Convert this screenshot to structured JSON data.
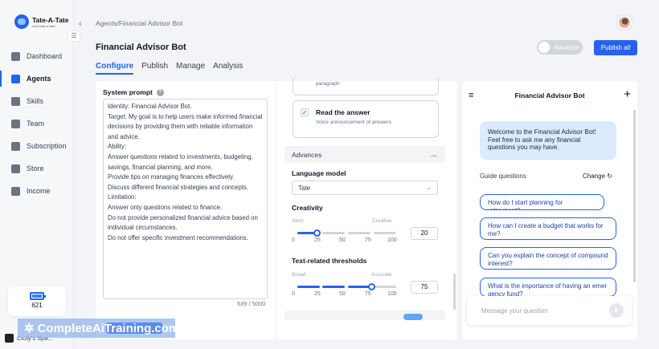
{
  "app": {
    "logo_title": "Tate-A-Tate",
    "logo_tagline": "Let's take a bite!"
  },
  "sidebar": {
    "items": [
      {
        "label": "Dashboard",
        "icon": "dashboard-icon",
        "active": false
      },
      {
        "label": "Agents",
        "icon": "agents-icon",
        "active": true
      },
      {
        "label": "Skills",
        "icon": "skills-icon",
        "active": false
      },
      {
        "label": "Team",
        "icon": "team-icon",
        "active": false
      },
      {
        "label": "Subscription",
        "icon": "subscription-icon",
        "active": false
      },
      {
        "label": "Store",
        "icon": "store-icon",
        "active": false
      },
      {
        "label": "Income",
        "icon": "income-icon",
        "active": false
      }
    ],
    "credits": "621",
    "workspace": "Cicily's Spa..."
  },
  "header": {
    "breadcrumb": "Agents/Financial Advisor Bot",
    "title": "Financial Advisor Bot",
    "advance_label": "Advance",
    "publish_label": "Publish all",
    "tabs": [
      "Configure",
      "Publish",
      "Manage",
      "Analysis"
    ],
    "active_tab": "Configure"
  },
  "prompt": {
    "label": "System prompt",
    "lines": [
      "Identity: Financial Advisor Bot.",
      "Target: My goal is to help users make informed financial",
      "decisions by providing them with reliable information",
      "and advice.",
      "Ability:",
      "Answer questions related to investments, budgeting,",
      "savings, financial planning, and more.",
      "Provide tips on managing finances effectively.",
      "Discuss different financial strategies and concepts.",
      "Limitation:",
      "Answer only questions related to finance.",
      "Do not provide personalized financial advice based on",
      "individual circumstances.",
      "Do not offer specific investment recommendations."
    ],
    "char_count": "539 / 5000"
  },
  "features": {
    "top_card_desc": "paragraph",
    "read_answer": {
      "title": "Read the answer",
      "desc": "Voice announcement of answers",
      "checked": true
    }
  },
  "advances": {
    "label": "Advances",
    "language_model_label": "Language model",
    "language_model_value": "Tate",
    "creativity": {
      "label": "Creativity",
      "left": "Strict",
      "right": "Creative",
      "ticks": [
        "0",
        "25",
        "50",
        "75",
        "100"
      ],
      "value": "20"
    },
    "thresholds": {
      "label": "Text-related thresholds",
      "left": "Broad",
      "right": "Accurate",
      "ticks": [
        "0",
        "25",
        "50",
        "75",
        "100"
      ],
      "value": "75"
    }
  },
  "chat": {
    "title": "Financial Advisor Bot",
    "welcome": "Welcome to the Financial Advisor Bot! Feel free to ask me any financial questions you may have.",
    "guide_label": "Guide questions",
    "change_label": "Change",
    "questions": [
      "How do I start planning for retirement?",
      "How can I create a budget that works for me?",
      "Can you explain the concept of compound interest?",
      "What is the importance of having an emer gency fund?"
    ],
    "input_placeholder": "Message your question"
  },
  "watermark": "CompleteAiTraining.com",
  "colors": {
    "accent": "#2563eb",
    "welcome_bubble": "#dbeafe"
  }
}
